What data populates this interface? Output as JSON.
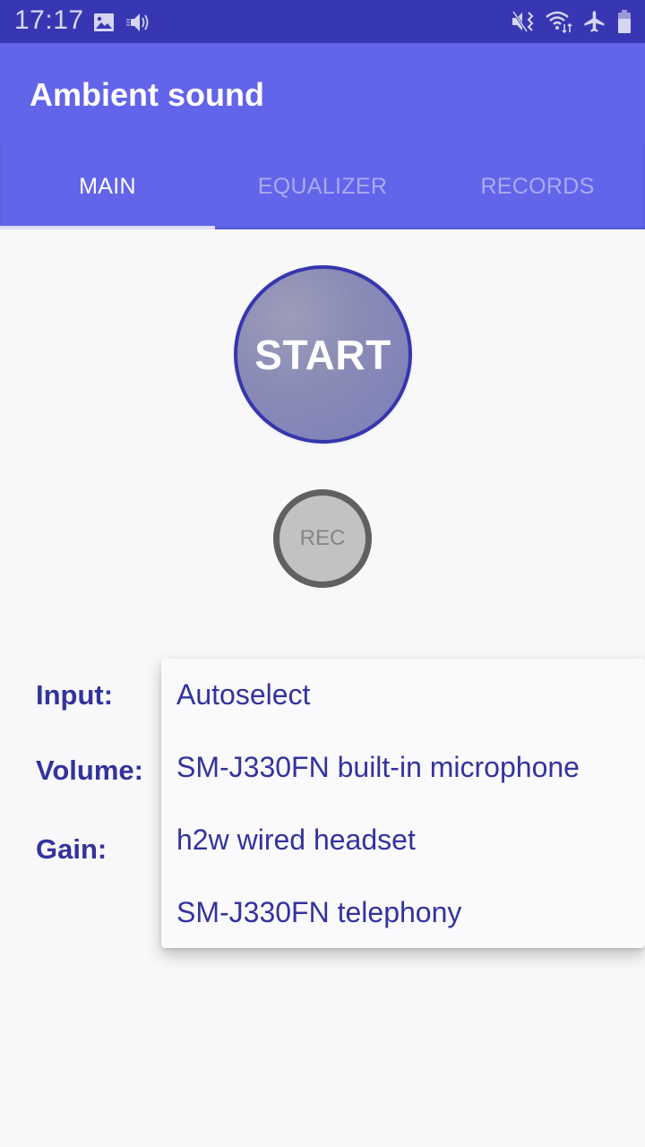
{
  "status_bar": {
    "time": "17:17",
    "left_icons": [
      "image-icon",
      "volume-icon"
    ],
    "right_icons": [
      "vibrate-mute-icon",
      "wifi-icon",
      "airplane-mode-icon",
      "battery-icon"
    ]
  },
  "app_bar": {
    "title": "Ambient sound"
  },
  "tabs": [
    {
      "label": "MAIN",
      "active": true
    },
    {
      "label": "EQUALIZER",
      "active": false
    },
    {
      "label": "RECORDS",
      "active": false
    }
  ],
  "main": {
    "start_button_label": "START",
    "rec_button_label": "REC",
    "labels": {
      "input": "Input:",
      "volume": "Volume:",
      "gain": "Gain:"
    }
  },
  "input_dropdown": {
    "options": [
      "Autoselect",
      "SM-J330FN built-in microphone",
      "h2w wired headset",
      "SM-J330FN telephony"
    ]
  },
  "colors": {
    "status_bar": "#3737b4",
    "primary": "#6264ea",
    "accent_text": "#33339e",
    "background": "#f8f8fa"
  }
}
